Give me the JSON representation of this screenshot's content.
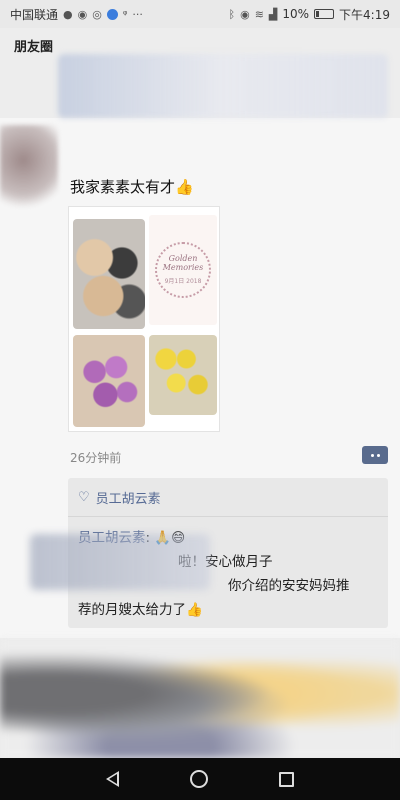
{
  "status_bar": {
    "carrier": "中国联通",
    "battery_percent": "10%",
    "time": "下午4:19",
    "icons": [
      "wechat-icon",
      "qq-icon",
      "messenger-icon",
      "blue-app-icon",
      "location-icon",
      "more-icon",
      "bluetooth-icon",
      "eye-icon",
      "wifi-icon",
      "signal-icon",
      "battery-icon"
    ]
  },
  "nav": {
    "title": "朋友圈"
  },
  "post": {
    "text": "我家素素太有才",
    "text_emoji": "👍",
    "image": {
      "card_title_line1": "Golden",
      "card_title_line2": "Memories",
      "card_date": "9月1日 2018",
      "photos": [
        "black-white-buns",
        "golden-memories-card",
        "purple-flower-buns",
        "yellow-chick-buns"
      ]
    },
    "time_ago": "26分钟前"
  },
  "comments": {
    "likes": "员工胡云素",
    "items": [
      {
        "name": "员工胡云素",
        "text": ": 🙏😄"
      },
      {
        "name": "",
        "text": "啦！安心做月子"
      },
      {
        "name": "",
        "text": "你介绍的安安妈妈推"
      },
      {
        "name": "",
        "text": "荐的月嫂太给力了👍"
      }
    ]
  },
  "colors": {
    "link_blue": "#576b95",
    "background": "#ededed",
    "card": "#f6f6f6"
  }
}
